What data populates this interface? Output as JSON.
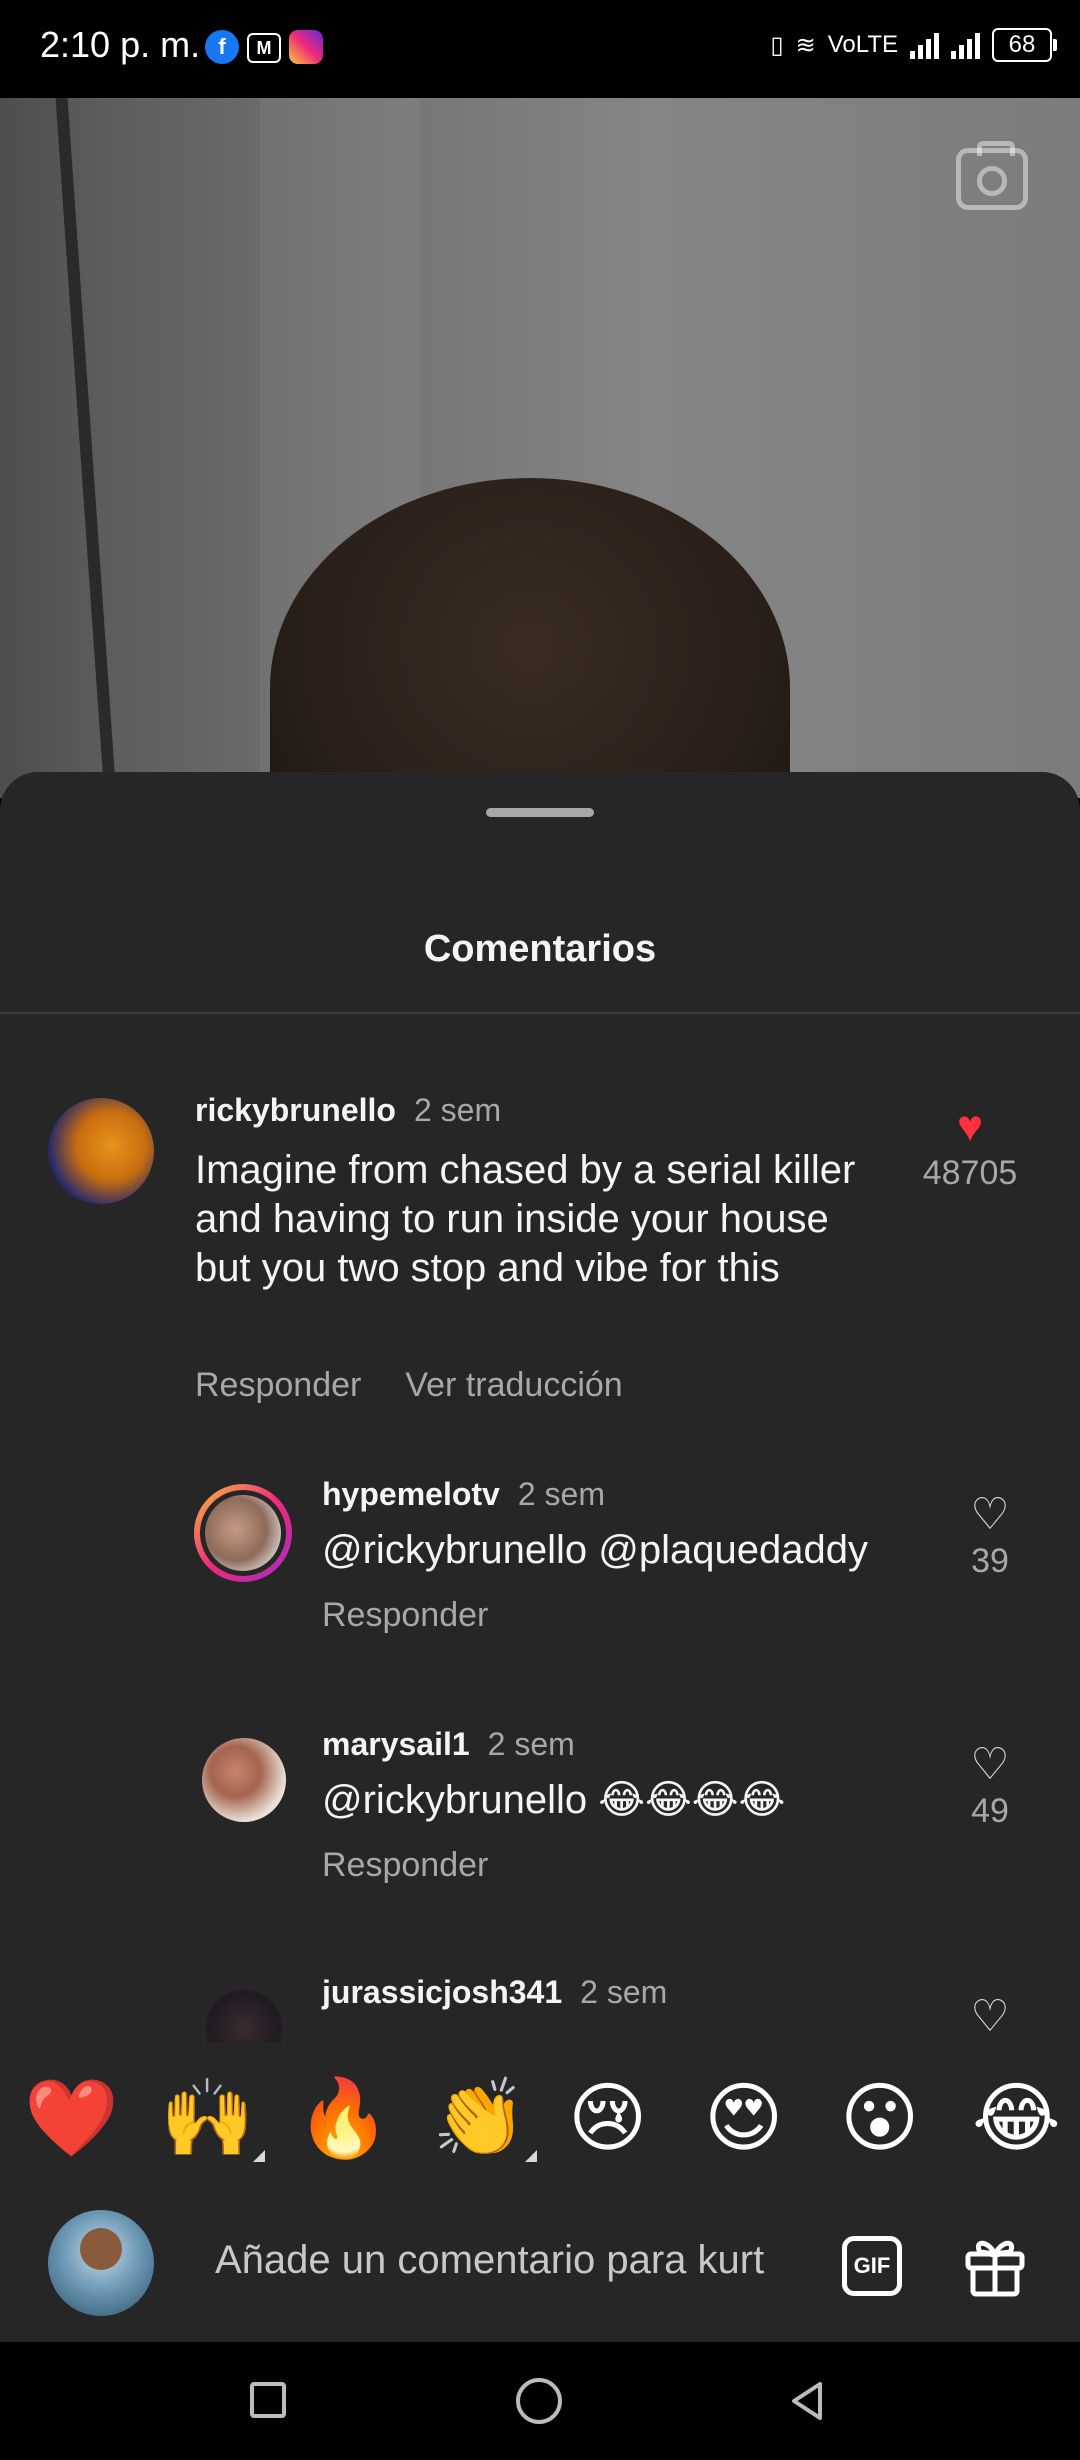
{
  "status_bar": {
    "time": "2:10 p. m.",
    "apps": [
      "facebook-icon",
      "gmail-icon",
      "instagram-icon"
    ],
    "network": "VoLTE",
    "battery": "68"
  },
  "video": {
    "camera_icon": "camera-icon"
  },
  "sheet": {
    "title": "Comentarios"
  },
  "comments": [
    {
      "user": "rickybrunello",
      "time": "2 sem",
      "text": "Imagine from chased by a serial killer and having to run inside your house but you two stop and vibe for this",
      "actions": [
        "Responder",
        "Ver traducción"
      ],
      "likes": "48705",
      "liked": true
    },
    {
      "user": "hypemelotv",
      "time": "2 sem",
      "text": "@rickybrunello @plaquedaddy",
      "actions": [
        "Responder"
      ],
      "likes": "39",
      "liked": false
    },
    {
      "user": "marysail1",
      "time": "2 sem",
      "text": "@rickybrunello 😂😂😂😂",
      "actions": [
        "Responder"
      ],
      "likes": "49",
      "liked": false
    },
    {
      "user": "jurassicjosh341",
      "time": "2 sem",
      "text": "",
      "actions": [],
      "likes": "",
      "liked": false
    }
  ],
  "emoji_bar": [
    "❤️",
    "🙌",
    "🔥",
    "👏",
    "😢",
    "😍",
    "😮",
    "😂"
  ],
  "composer": {
    "placeholder": "Añade un comentario para kurt",
    "gif_label": "GIF"
  },
  "colors": {
    "sheet_bg": "#262626",
    "liked_heart": "#ff3040",
    "secondary_text": "#a8a8a8"
  }
}
